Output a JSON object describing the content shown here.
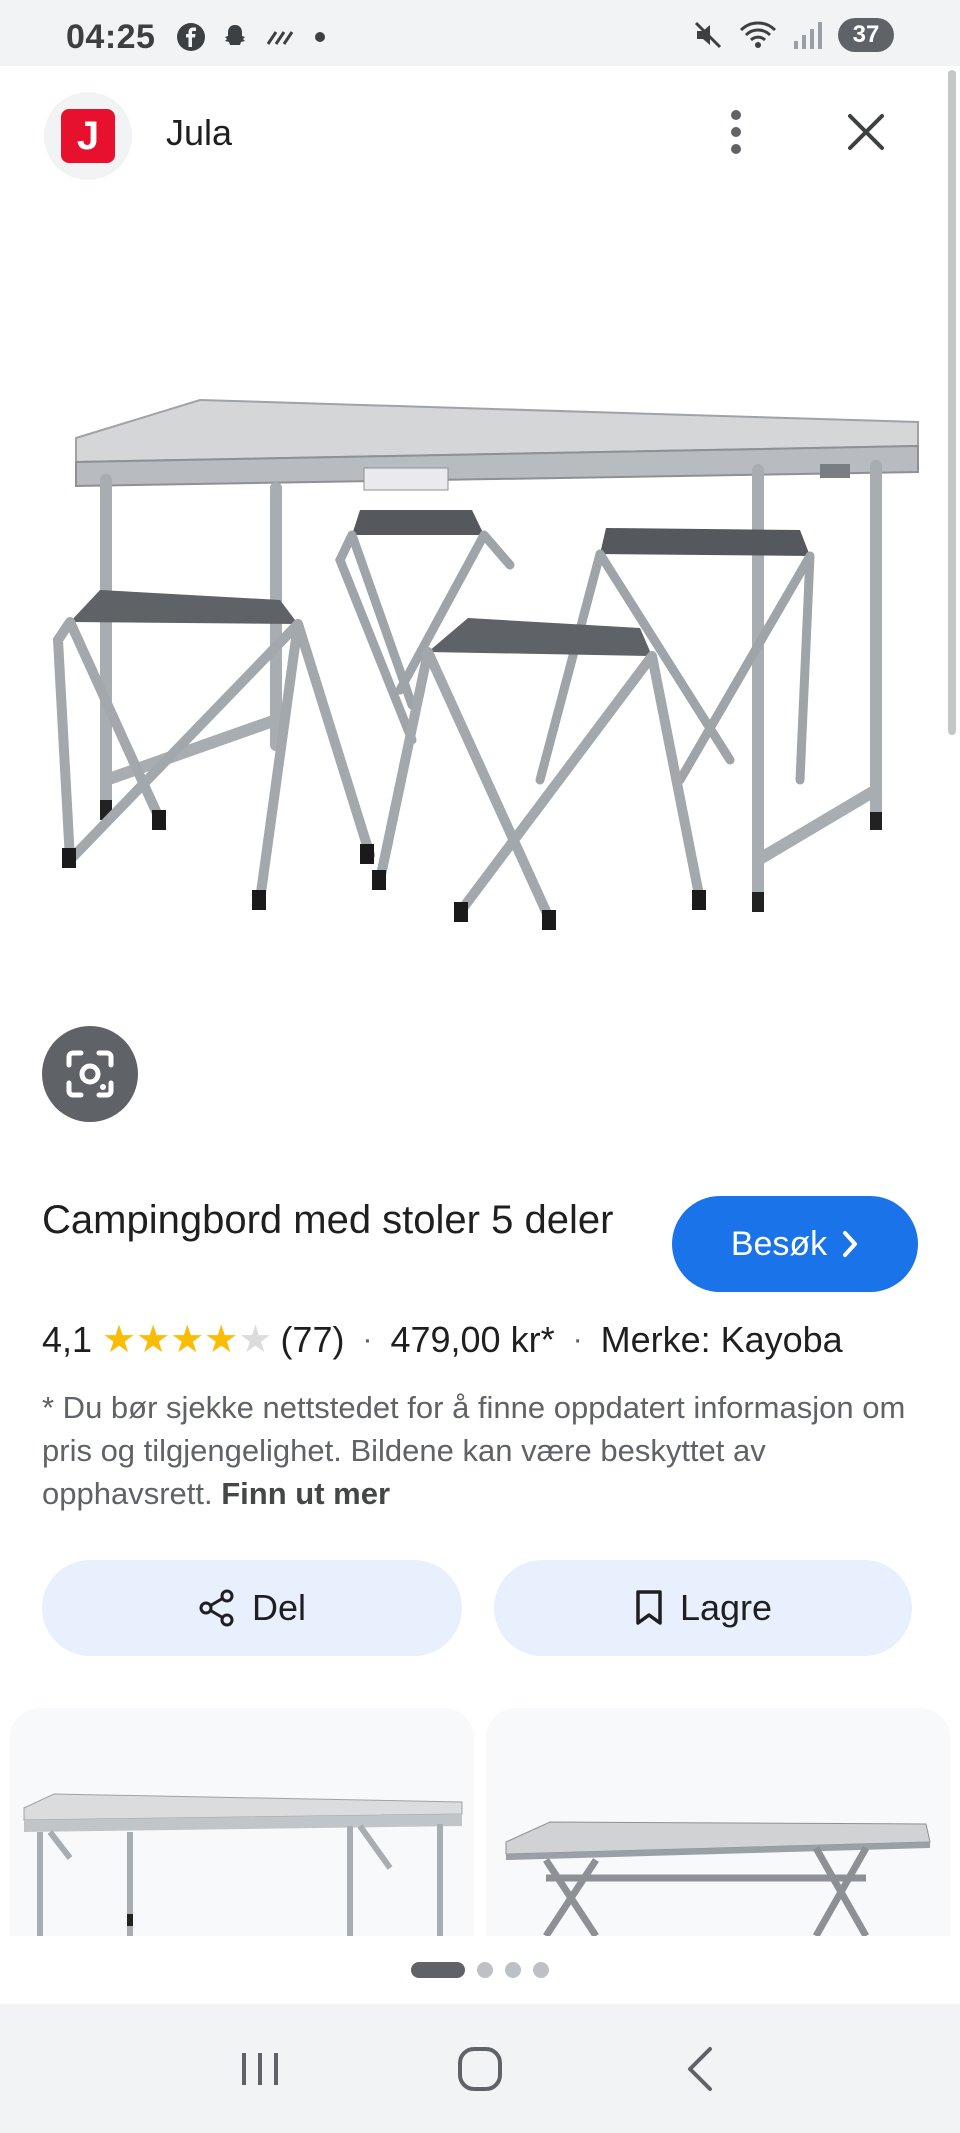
{
  "status_bar": {
    "time": "04:25",
    "battery": "37",
    "left_icons": [
      "facebook-icon",
      "snapchat-icon",
      "signal-boost-icon",
      "dot-icon"
    ],
    "right_icons": [
      "mute-icon",
      "wifi-icon",
      "cell-signal-icon",
      "battery-icon"
    ]
  },
  "header": {
    "site_name": "Jula",
    "logo_letter": "J",
    "logo_color": "#e8112d",
    "menu_icon": "more-vert-icon",
    "close_icon": "close-icon"
  },
  "product": {
    "title": "Campingbord med stoler 5 deler",
    "visit_label": "Besøk",
    "rating": "4,1",
    "stars_filled": 4,
    "stars_total": 5,
    "review_count": "(77)",
    "price": "479,00 kr*",
    "brand": "Merke: Kayoba",
    "separator": "·",
    "disclaimer": "* Du bør sjekke nettstedet for å finne oppdatert informasjon om pris og tilgjengelighet. Bildene kan være beskyttet av opphavsrett.",
    "learn_more": "Finn ut mer"
  },
  "actions": {
    "share_label": "Del",
    "save_label": "Lagre"
  },
  "pager": {
    "pages": 4,
    "active": 1
  },
  "colors": {
    "accent": "#1a73e8",
    "star": "#fbbc04",
    "action_bg": "#e8f0fe"
  }
}
